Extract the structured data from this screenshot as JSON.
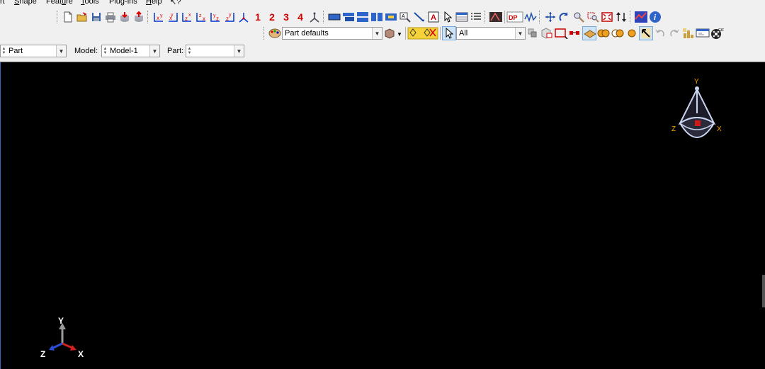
{
  "menubar": {
    "items": [
      {
        "key": "part",
        "label": "rt"
      },
      {
        "key": "shape",
        "pre": "",
        "ul": "S",
        "post": "hape"
      },
      {
        "key": "feature",
        "pre": "Feat",
        "ul": "u",
        "post": "re"
      },
      {
        "key": "tools",
        "pre": "",
        "ul": "T",
        "post": "ools"
      },
      {
        "key": "plugins",
        "pre": "Plu",
        "ul": "g",
        "post": "-ins"
      },
      {
        "key": "help",
        "pre": "",
        "ul": "H",
        "post": "elp"
      }
    ]
  },
  "toolbar": {
    "view_numbers": [
      "1",
      "2",
      "3",
      "4"
    ],
    "render_style": "Part defaults",
    "selection_filter": "All"
  },
  "context": {
    "module_value": "Part",
    "model_label": "Model:",
    "model_value": "Model-1",
    "part_label": "Part:",
    "part_value": ""
  },
  "viewport": {
    "background": "#000000",
    "triad": {
      "x": "X",
      "y": "Y",
      "z": "Z"
    },
    "view_cube": {
      "x": "X",
      "y": "Y",
      "z": "Z"
    }
  },
  "colors": {
    "accent_red": "#d40000",
    "axis_x": "#d02020",
    "axis_y": "#9a9a9a",
    "axis_z": "#2a4fd0",
    "cube_label": "#f5a000"
  }
}
